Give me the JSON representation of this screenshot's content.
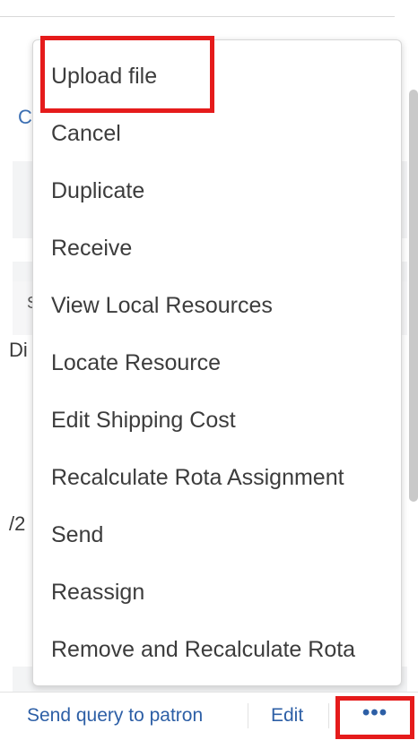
{
  "background": {
    "frag_c": "C",
    "frag_s": "S",
    "frag_di": "Di",
    "frag_y2": "/2"
  },
  "menu": {
    "items": [
      {
        "label": "Upload file"
      },
      {
        "label": "Cancel"
      },
      {
        "label": "Duplicate"
      },
      {
        "label": "Receive"
      },
      {
        "label": "View Local Resources"
      },
      {
        "label": "Locate Resource"
      },
      {
        "label": "Edit Shipping Cost"
      },
      {
        "label": "Recalculate Rota Assignment"
      },
      {
        "label": "Send"
      },
      {
        "label": "Reassign"
      },
      {
        "label": "Remove and Recalculate Rota"
      }
    ]
  },
  "actions": {
    "send_query": "Send query to patron",
    "edit": "Edit",
    "more": "•••"
  },
  "colors": {
    "highlight": "#e51b1b",
    "link": "#2d5fa6"
  }
}
